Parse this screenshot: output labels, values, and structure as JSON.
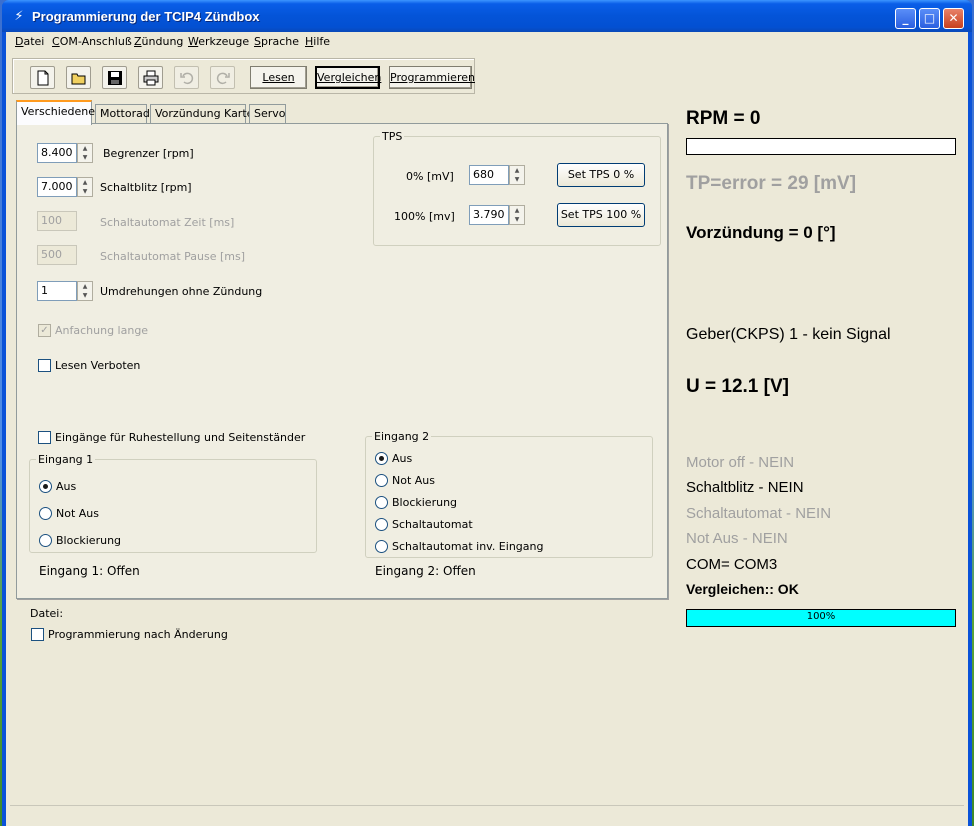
{
  "window": {
    "title": "Programmierung der TCIP4 Zündbox"
  },
  "menu": [
    {
      "pre": "",
      "u": "D",
      "post": "atei"
    },
    {
      "pre": "",
      "u": "C",
      "post": "OM-Anschluß"
    },
    {
      "pre": "",
      "u": "Z",
      "post": "ündung"
    },
    {
      "pre": "",
      "u": "W",
      "post": "erkzeuge"
    },
    {
      "pre": "",
      "u": "S",
      "post": "prache"
    },
    {
      "pre": "",
      "u": "H",
      "post": "ilfe"
    }
  ],
  "toolbar": {
    "lesen": "Lesen",
    "vergleichen": "Vergleichen",
    "programmieren": "Programmieren"
  },
  "tabs": [
    "Verschiedene",
    "Mottorad",
    "Vorzündung Karte",
    "Servo"
  ],
  "fields": {
    "begrenzer": {
      "value": "8.400",
      "label": "Begrenzer [rpm]"
    },
    "schaltblitz": {
      "value": "7.000",
      "label": "Schaltblitz [rpm]"
    },
    "schaltautomat_zeit": {
      "value": "100",
      "label": "Schaltautomat Zeit [ms]"
    },
    "schaltautomat_pause": {
      "value": "500",
      "label": "Schaltautomat Pause [ms]"
    },
    "umdrehungen": {
      "value": "1",
      "label": "Umdrehungen ohne Zündung"
    }
  },
  "checks": {
    "anfachung": "Anfachung lange",
    "lesen_verboten": "Lesen Verboten",
    "eingaenge": "Eingänge für Ruhestellung und Seitenständer",
    "programmierung": "Programmierung nach Änderung"
  },
  "tps": {
    "title": "TPS",
    "row0": {
      "label": "0%  [mV]",
      "value": "680",
      "button": "Set TPS 0 %"
    },
    "row100": {
      "label": "100%  [mv]",
      "value": "3.790",
      "button": "Set TPS 100 %"
    }
  },
  "eingang1": {
    "title": "Eingang 1",
    "options": [
      "Aus",
      "Not Aus",
      "Blockierung"
    ],
    "status": "Eingang 1: Offen"
  },
  "eingang2": {
    "title": "Eingang 2",
    "options": [
      "Aus",
      "Not Aus",
      "Blockierung",
      "Schaltautomat",
      "Schaltautomat inv. Eingang"
    ],
    "status": "Eingang 2: Offen"
  },
  "datei_label": "Datei:",
  "status": {
    "rpm": "RPM = 0",
    "tp": "TP=error = 29 [mV]",
    "vorzuendung": "Vorzündung = 0 [°]",
    "geber": "Geber(CKPS) 1 -  kein Signal",
    "voltage": "U = 12.1 [V]",
    "motor_off": "Motor off - NEIN",
    "schaltblitz": "Schaltblitz - NEIN",
    "schaltautomat": "Schaltautomat - NEIN",
    "not_aus": "Not Aus - NEIN",
    "com": "COM= COM3",
    "vergleichen": "Vergleichen:: OK",
    "progress_label": "100%",
    "progress_value": 100
  },
  "colors": {
    "progress_fill": "#00ffff",
    "disabled_text": "#a0a0a0",
    "title_bar": "#0454d8"
  }
}
